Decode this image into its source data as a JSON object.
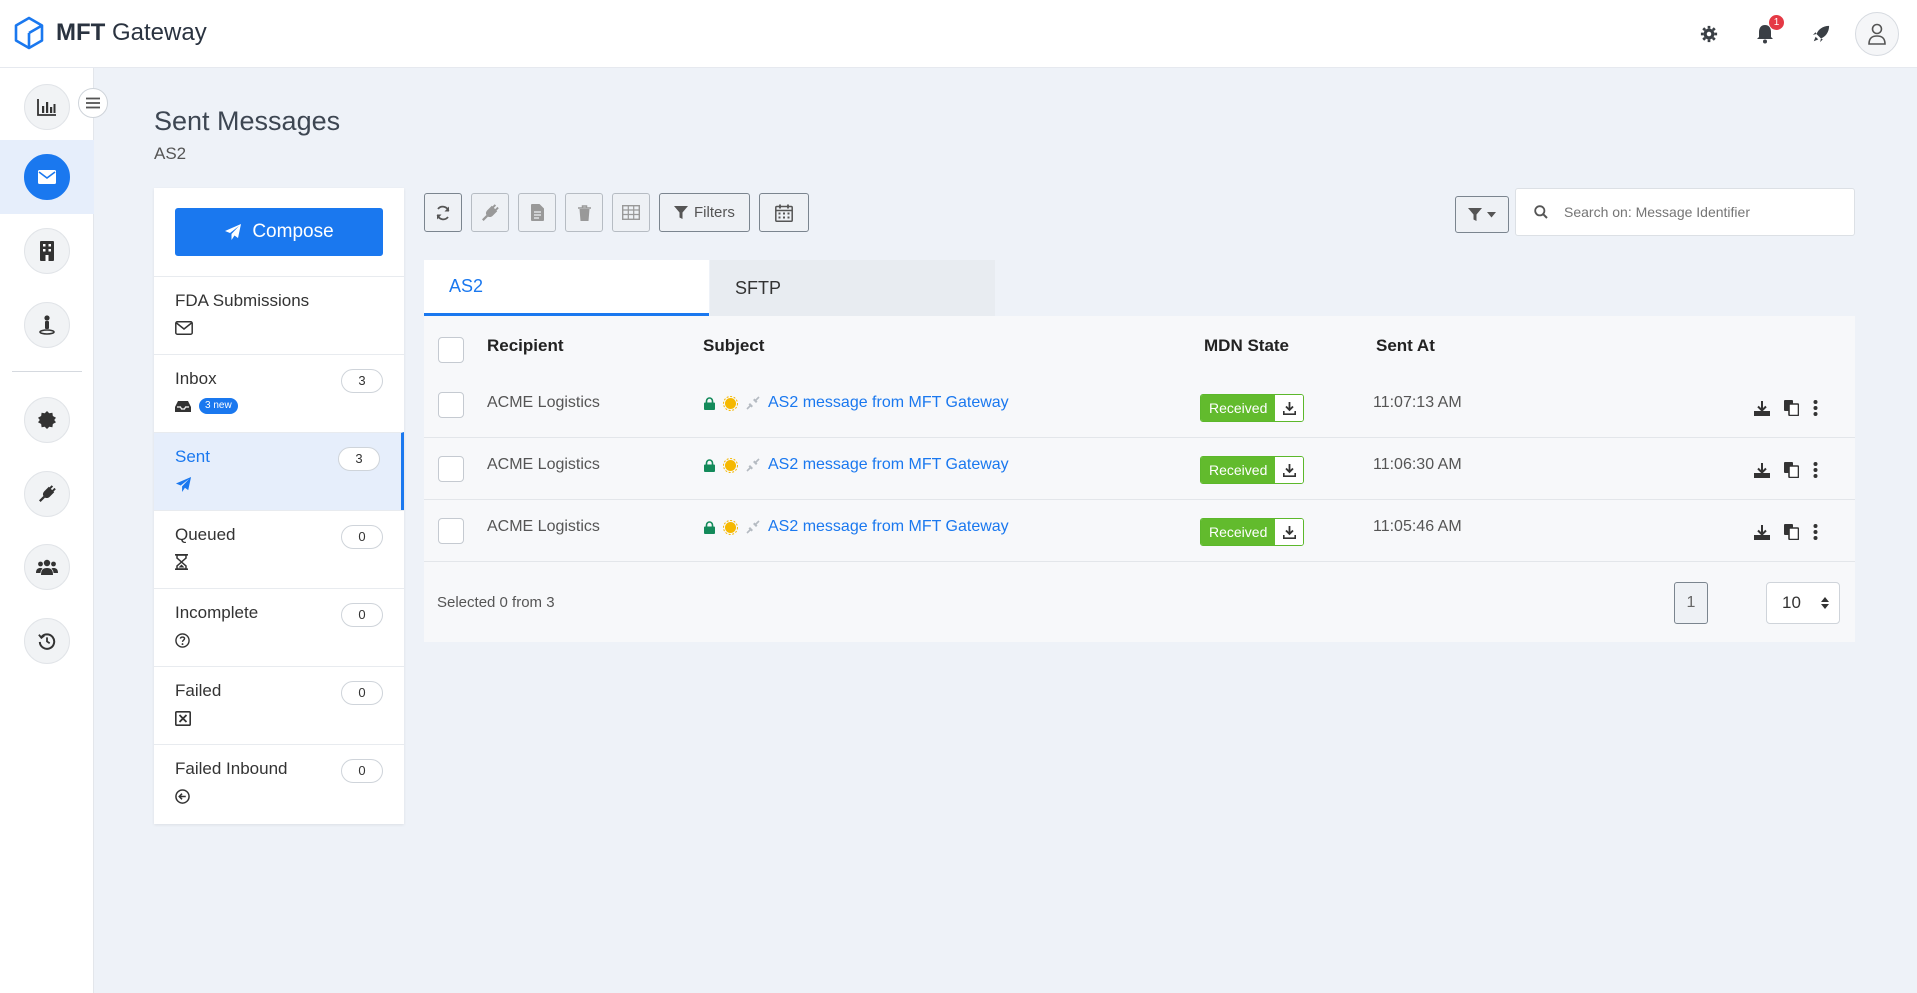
{
  "app": {
    "brand_bold": "MFT",
    "brand_rest": " Gateway"
  },
  "header": {
    "notification_count": "1"
  },
  "page": {
    "title": "Sent Messages",
    "subtitle": "AS2"
  },
  "compose": {
    "label": "Compose"
  },
  "folders": [
    {
      "name": "FDA Submissions",
      "count": "",
      "icon": "envelope-icon"
    },
    {
      "name": "Inbox",
      "count": "3",
      "icon": "inbox-icon",
      "badge": "3 new"
    },
    {
      "name": "Sent",
      "count": "3",
      "icon": "paper-plane-icon"
    },
    {
      "name": "Queued",
      "count": "0",
      "icon": "hourglass-icon"
    },
    {
      "name": "Incomplete",
      "count": "0",
      "icon": "question-circle-icon"
    },
    {
      "name": "Failed",
      "count": "0",
      "icon": "x-square-icon"
    },
    {
      "name": "Failed Inbound",
      "count": "0",
      "icon": "arrow-circle-left-icon"
    }
  ],
  "toolbar": {
    "filters_label": "Filters"
  },
  "search": {
    "placeholder": "Search on: Message Identifier"
  },
  "tabs": [
    {
      "label": "AS2"
    },
    {
      "label": "SFTP"
    }
  ],
  "table": {
    "headers": {
      "recipient": "Recipient",
      "subject": "Subject",
      "mdn_state": "MDN State",
      "sent_at": "Sent At"
    },
    "rows": [
      {
        "recipient": "ACME Logistics",
        "subject": "AS2 message from MFT Gateway",
        "mdn_state": "Received",
        "sent_at": "11:07:13 AM"
      },
      {
        "recipient": "ACME Logistics",
        "subject": "AS2 message from MFT Gateway",
        "mdn_state": "Received",
        "sent_at": "11:06:30 AM"
      },
      {
        "recipient": "ACME Logistics",
        "subject": "AS2 message from MFT Gateway",
        "mdn_state": "Received",
        "sent_at": "11:05:46 AM"
      }
    ],
    "footer": "Selected 0 from 3",
    "page": "1",
    "page_size": "10"
  },
  "colors": {
    "accent": "#1a78ef",
    "success": "#62bb2d",
    "lock": "#138a5a",
    "sun": "#f5b800"
  }
}
